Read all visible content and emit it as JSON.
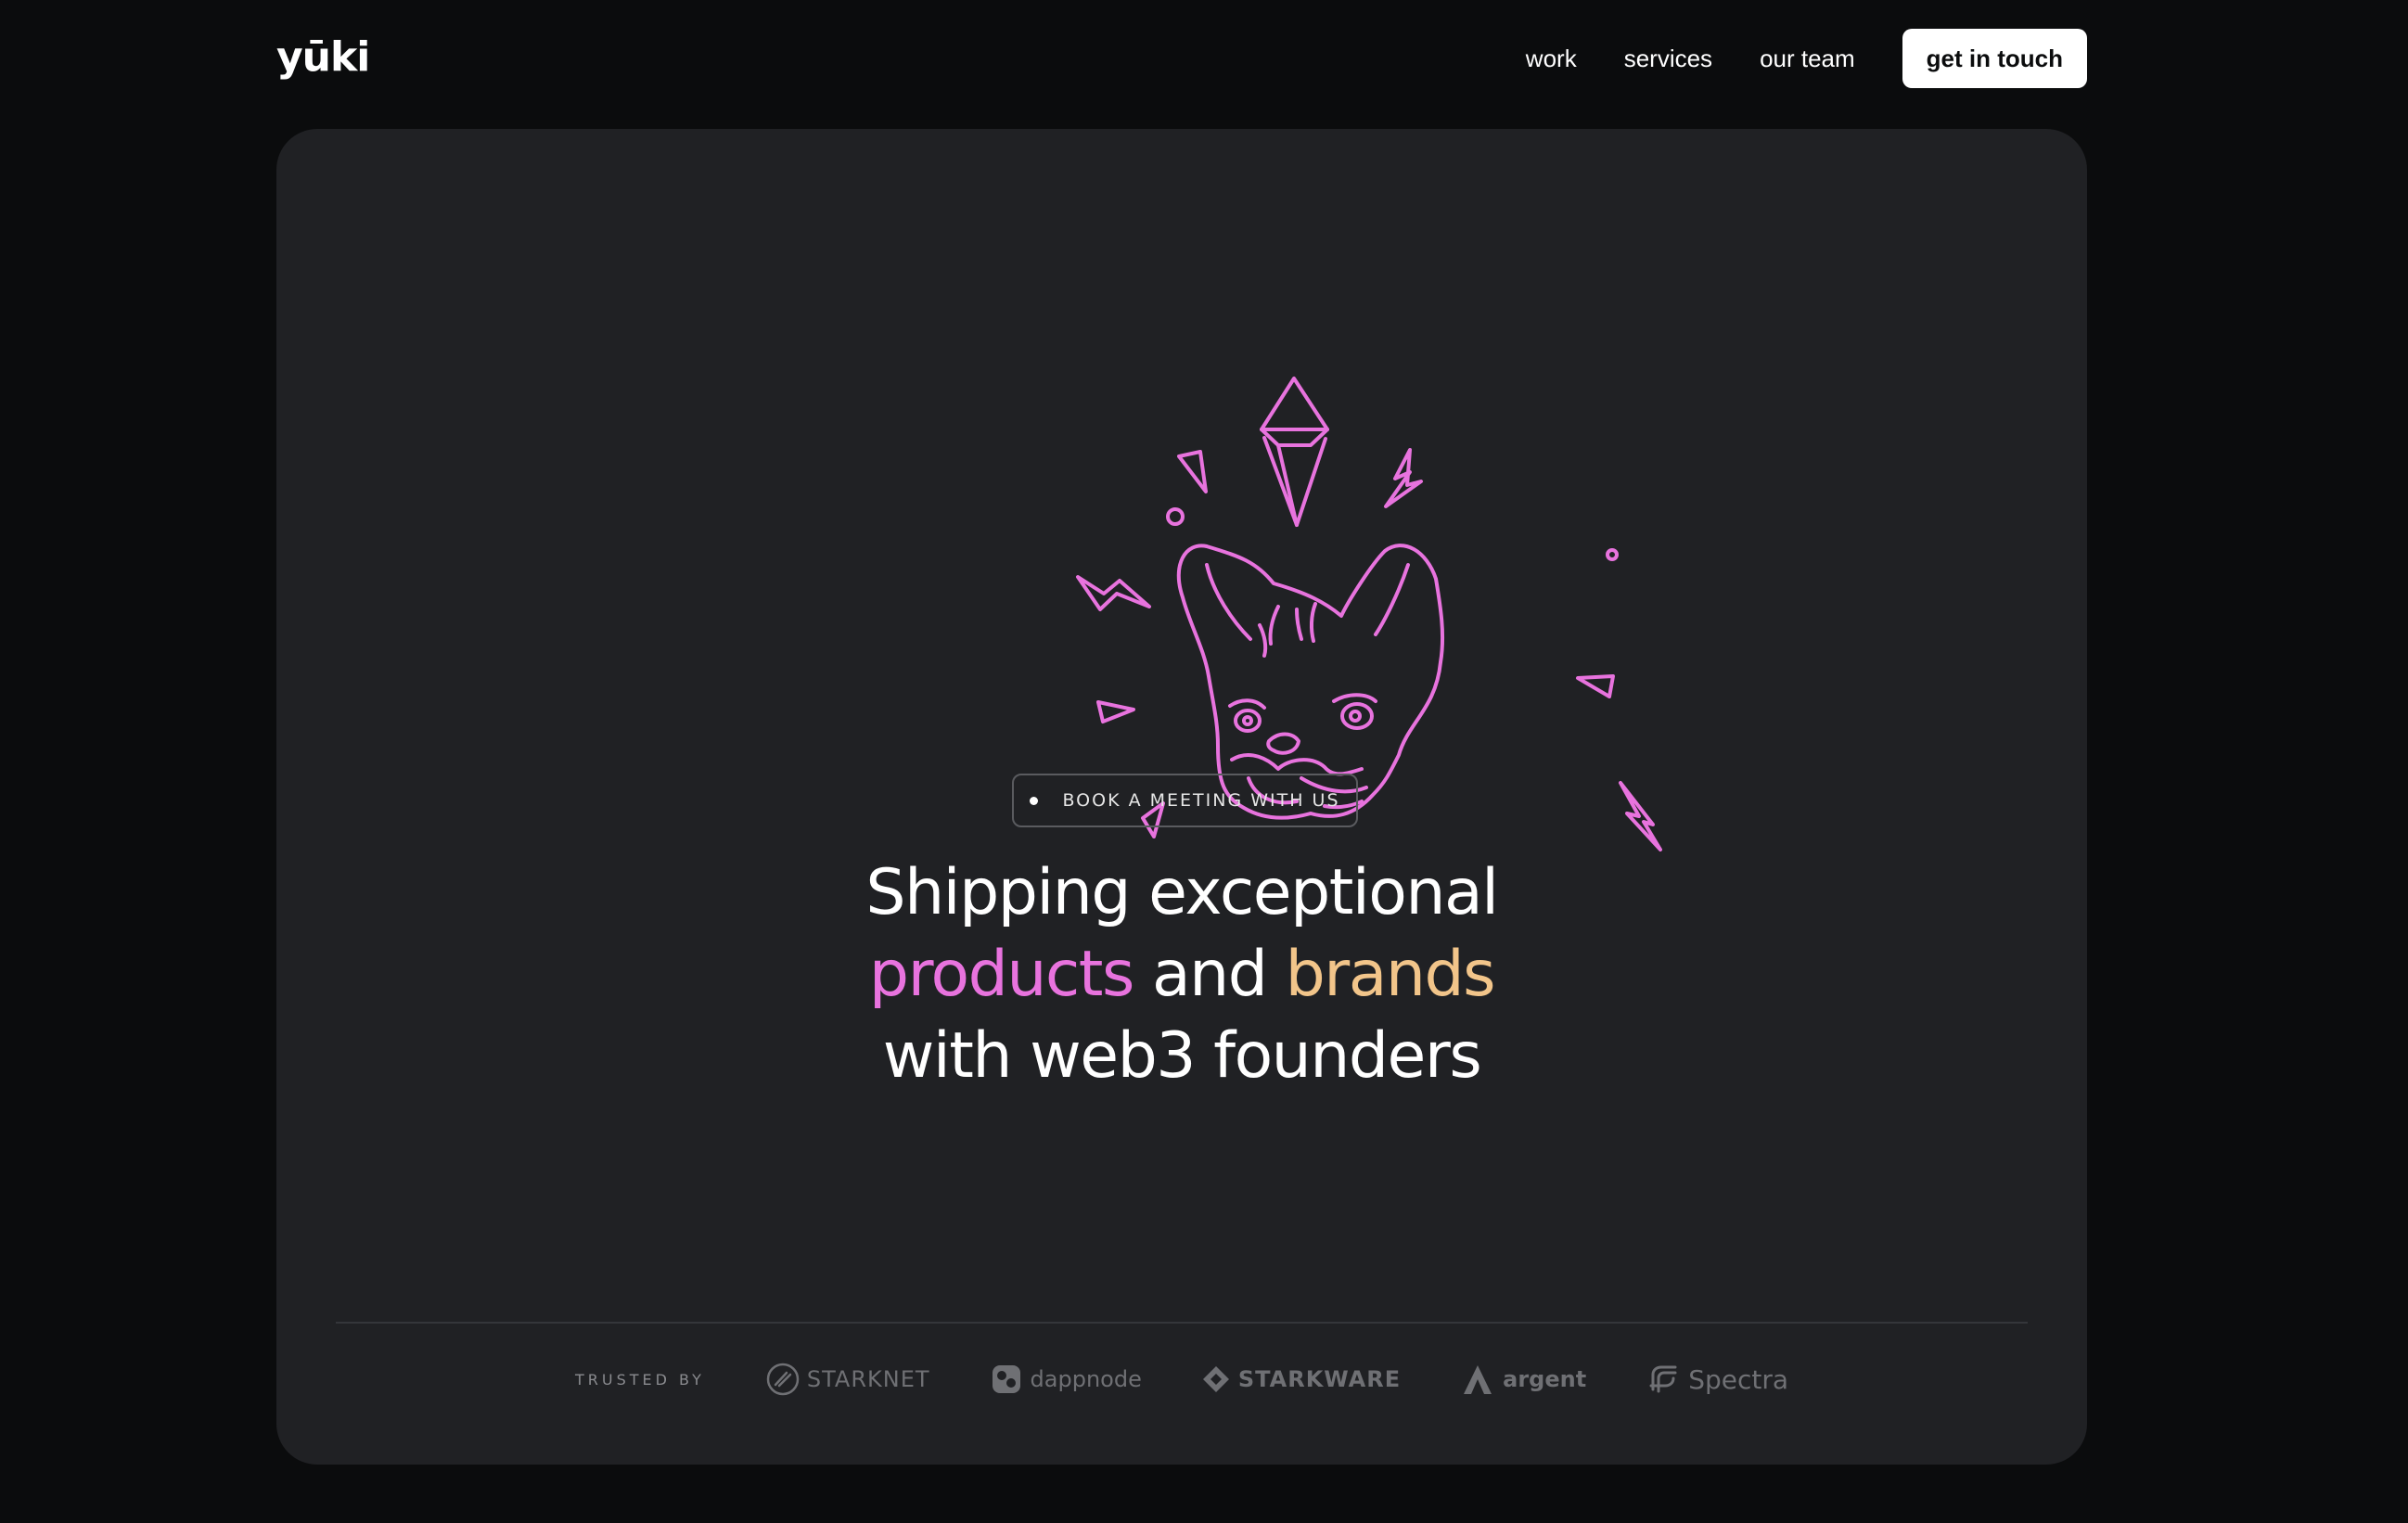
{
  "header": {
    "logo": "yūki",
    "nav": [
      {
        "label": "work"
      },
      {
        "label": "services"
      },
      {
        "label": "our team"
      }
    ],
    "cta_label": "get in touch"
  },
  "hero": {
    "meeting_button": "BOOK A MEETING WITH US",
    "headline": {
      "line1": "Shipping exceptional",
      "word_products": "products",
      "word_and": "and",
      "word_brands": "brands",
      "line3": "with web3 founders"
    }
  },
  "trusted": {
    "label": "TRUSTED BY",
    "partners": [
      {
        "name": "STARKNET"
      },
      {
        "name": "dappnode"
      },
      {
        "name": "STARKWARE"
      },
      {
        "name": "argent"
      },
      {
        "name": "Spectra"
      }
    ]
  },
  "colors": {
    "background": "#0b0c0d",
    "card": "#202124",
    "accent_pink": "#e873de",
    "accent_gold": "#f2c58a",
    "logo_gray": "#6f7074"
  }
}
